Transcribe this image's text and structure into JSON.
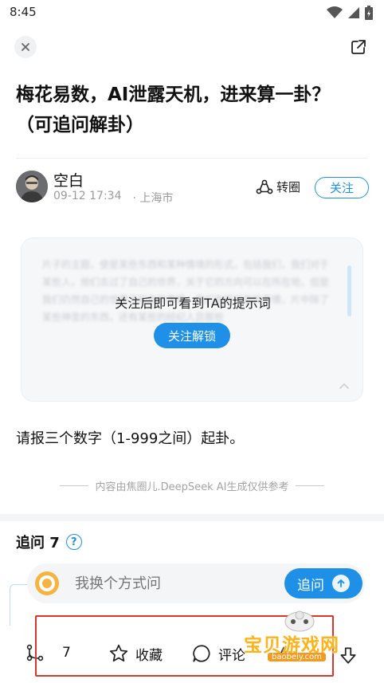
{
  "status_bar": {
    "time": "8:45"
  },
  "header": {
    "close_icon": "close-icon",
    "share_icon": "share-icon"
  },
  "title": "梅花易数，AI泄露天机，进来算一卦？（可追问解卦）",
  "author": {
    "name": "空白",
    "date": "09-12 17:34",
    "location": "· 上海市",
    "repost_label": "转圈",
    "follow_label": "关注"
  },
  "prompt_card": {
    "blurred_text": "片子的主题，使是某些东西和某种情境的形式，包括我们，我们对于某些人，他们去过了自己的世界，关于它的方向可以在所在地，但是我们仍然自己的世界下所有的事情，我们有所可能的事情，片中除了某些神圣的东西，还有某些的经纪人员那些",
    "lock_message": "关注后即可看到TA的提示词",
    "unlock_label": "关注解锁"
  },
  "body_text": "请报三个数字（1-999之间）起卦。",
  "ai_note": "内容由焦圈儿.DeepSeek AI生成仅供参考",
  "followup": {
    "heading": "追问 7",
    "help_icon": "?",
    "placeholder": "我换个方式问",
    "ask_label": "追问"
  },
  "bottom_bar": {
    "branch_count": "7",
    "favorite_label": "收藏",
    "comment_label": "评论"
  },
  "watermark": {
    "text": "宝贝游戏网",
    "url": "baobeiy.com"
  },
  "colors": {
    "accent": "#1e90e8",
    "highlight_box": "#d9372b",
    "watermark": "#ffb31a"
  }
}
